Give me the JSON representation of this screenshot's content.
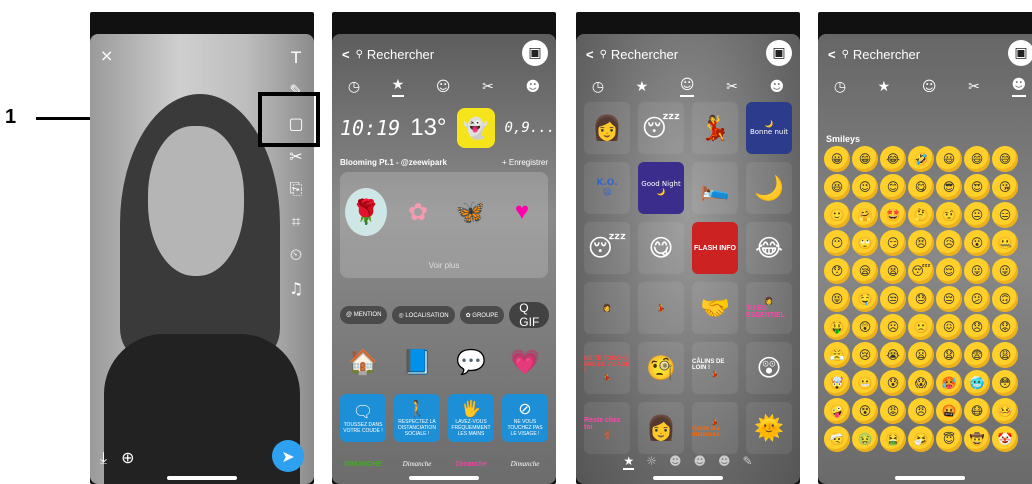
{
  "annotation": {
    "label": "1"
  },
  "panel1": {
    "close_icon": "×",
    "tools": [
      "T",
      "✎",
      "▢",
      "✂",
      "⎘",
      "⌗",
      "⏲",
      "♫"
    ],
    "download_icon": "⤓",
    "add_story_icon": "⊕",
    "send_icon": "➤"
  },
  "search": {
    "back": "<",
    "icon": "🔍",
    "label": "Rechercher"
  },
  "tab_icons": [
    "◷",
    "★",
    "☺",
    "✂",
    "☻"
  ],
  "panel2": {
    "time": "10:19",
    "temp": "13°",
    "speed": "0,9...",
    "pack_title": "Blooming Pt.1 - @zeewipark",
    "save_label": "+ Enregistrer",
    "see_more": "Voir plus",
    "chips": [
      "@ MENTION",
      "◎ LOCALISATION",
      "✿ GROUPE"
    ],
    "gif_label": "Q GIF",
    "stickers_row1": [
      "🏠",
      "📘",
      "💬",
      "💗"
    ],
    "boxes": [
      {
        "icon": "🗨",
        "text": "TOUSSEZ DANS VOTRE COUDE !"
      },
      {
        "icon": "🚶",
        "text": "RESPECTEZ LA DISTANCIATION SOCIALE !"
      },
      {
        "icon": "🖐",
        "text": "LAVEZ-VOUS FRÉQUEMMENT LES MAINS"
      },
      {
        "icon": "⊘",
        "text": "NE VOUS TOUCHEZ PAS LE VISAGE !"
      }
    ],
    "dimanche": [
      "DIMANCHE",
      "Dimanche",
      "Dimanche",
      "Dimanche"
    ]
  },
  "panel3": {
    "stickers": [
      "Bonne nuit",
      "K.O.",
      "Good Night",
      "FLASH INFO",
      "TU ES ESSENTIEL",
      "NE TE TOUCHE PAS LE VISAGE !",
      "CÂLINS DE LOIN !",
      "Reste chez toi",
      "Garde tes distances"
    ],
    "bottom_tabs": [
      "★",
      "☼",
      "☻",
      "☻",
      "☻",
      "✎"
    ]
  },
  "panel4": {
    "section": "Smileys",
    "emojis": [
      "😀",
      "😁",
      "😂",
      "🤣",
      "😃",
      "😄",
      "😅",
      "😆",
      "😉",
      "😊",
      "😋",
      "😎",
      "😍",
      "😘",
      "🙂",
      "🤗",
      "🤩",
      "🤔",
      "🤨",
      "😐",
      "😑",
      "😶",
      "🙄",
      "😏",
      "😣",
      "😥",
      "😮",
      "🤐",
      "😯",
      "😪",
      "😫",
      "😴",
      "😌",
      "😛",
      "😜",
      "😝",
      "🤤",
      "😒",
      "😓",
      "😔",
      "😕",
      "🙃",
      "🤑",
      "😲",
      "☹",
      "🙁",
      "😖",
      "😞",
      "😟",
      "😤",
      "😢",
      "😭",
      "😦",
      "😧",
      "😨",
      "😩",
      "🤯",
      "😬",
      "😰",
      "😱",
      "🥵",
      "🥶",
      "😳",
      "🤪",
      "😵",
      "😡",
      "😠",
      "🤬",
      "😷",
      "🤒",
      "🤕",
      "🤢",
      "🤮",
      "🤧",
      "😇",
      "🤠",
      "🤡",
      "🥳",
      "🥴",
      "🥺",
      "🤥"
    ]
  }
}
